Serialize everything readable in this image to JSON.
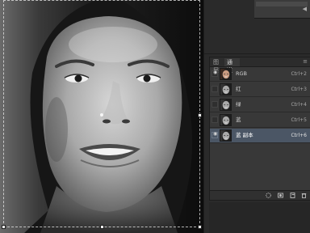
{
  "panel": {
    "tabs": [
      {
        "label": "图层",
        "active": false
      },
      {
        "label": "通道",
        "active": true
      }
    ],
    "menu_icon": "panel-menu-icon",
    "channels": [
      {
        "name": "RGB",
        "shortcut": "Ctrl+2",
        "visible": true,
        "selected": false,
        "thumb": "color"
      },
      {
        "name": "红",
        "shortcut": "Ctrl+3",
        "visible": false,
        "selected": false,
        "thumb": "gray"
      },
      {
        "name": "绿",
        "shortcut": "Ctrl+4",
        "visible": false,
        "selected": false,
        "thumb": "gray"
      },
      {
        "name": "蓝",
        "shortcut": "Ctrl+5",
        "visible": false,
        "selected": false,
        "thumb": "gray"
      },
      {
        "name": "蓝 副本",
        "shortcut": "Ctrl+6",
        "visible": true,
        "selected": true,
        "thumb": "gray"
      }
    ],
    "footer_buttons": [
      {
        "name": "load-channel-as-selection-button",
        "icon": "dotted-circle-icon"
      },
      {
        "name": "save-selection-as-channel-button",
        "icon": "mask-icon"
      },
      {
        "name": "create-new-channel-button",
        "icon": "new-page-icon"
      },
      {
        "name": "delete-channel-button",
        "icon": "trash-icon"
      }
    ]
  },
  "colors": {
    "selection": "#4b5665",
    "panel_bg": "#383838",
    "dock_bg": "#2a2a2a"
  }
}
